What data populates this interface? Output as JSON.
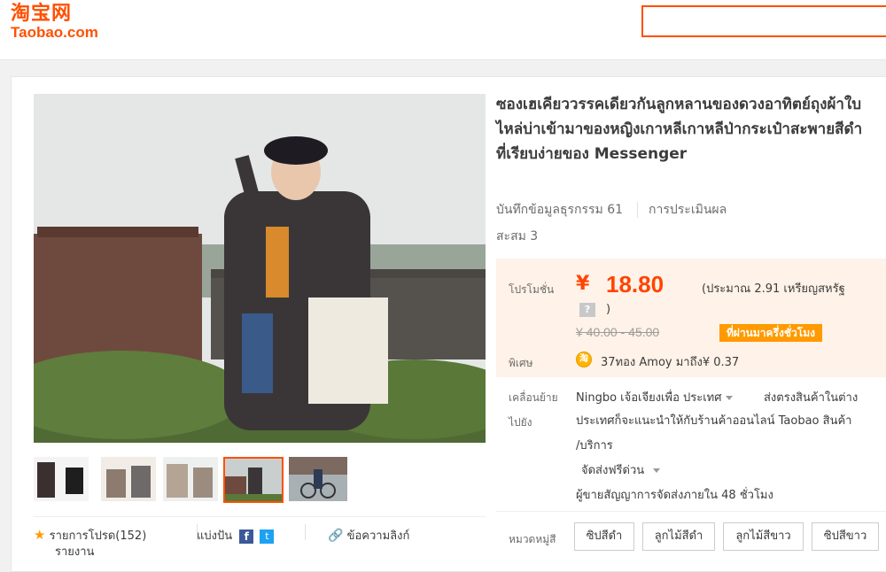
{
  "header": {
    "logo_cn": "淘宝网",
    "logo_en": "Taobao.com",
    "brand_color": "#ff5000"
  },
  "product": {
    "title": "ซองเฮเคียววรรคเดียวกันลูกหลานของดวงอาทิตย์ถุงผ้าใบไหล่บ่าเข้ามาของหญิงเกาหลีเกาหลีป่ากระเป๋าสะพายสีดำที่เรียบง่ายของ Messenger",
    "transactions": "บันทึกข้อมูลธุรกรรม 61",
    "reviews": "การประเมินผล",
    "collected": "สะสม 3"
  },
  "price": {
    "promo_label": "โปรโมชั่น",
    "currency": "¥",
    "value": "18.80",
    "approx": "(ประมาณ 2.91 เหรียญสหรัฐ",
    "qmark": "?",
    "close_paren": ")",
    "original": "¥ 40.00 - 45.00",
    "badge": "ที่ผ่านมาครึ่งชั่วโมง",
    "special_label": "พิเศษ",
    "coin_icon": "淘",
    "special_text": "37ทอง Amoy มาถึง¥ 0.37",
    "accent_color": "#ff4400"
  },
  "shipping": {
    "label_line1": "เคลื่อนย้าย",
    "label_line2": "ไปยัง",
    "origin": "Ningbo เจ้อเจียงเพื่อ ประเทศ",
    "line1_rest": "ส่งตรงสินค้าในต่าง",
    "line2": "ประเทศก็จะแนะนำให้กับร้านค้าออนไลน์ Taobao สินค้า",
    "line3": "/บริการ",
    "free_shipping": "จัดส่งฟรีด่วน",
    "commitment": "ผู้ขายสัญญาการจัดส่งภายใน 48 ชั่วโมง"
  },
  "category": {
    "label": "หมวดหมู่สี",
    "options": [
      "ซิปสีดำ",
      "ลูกไม้สีดำ",
      "ลูกไม้สีขาว",
      "ซิปสีขาว"
    ]
  },
  "social": {
    "favorite": "รายการโปรด(152)",
    "report": "รายงาน",
    "share": "แบ่งปัน",
    "link": "ข้อความลิงก์"
  }
}
